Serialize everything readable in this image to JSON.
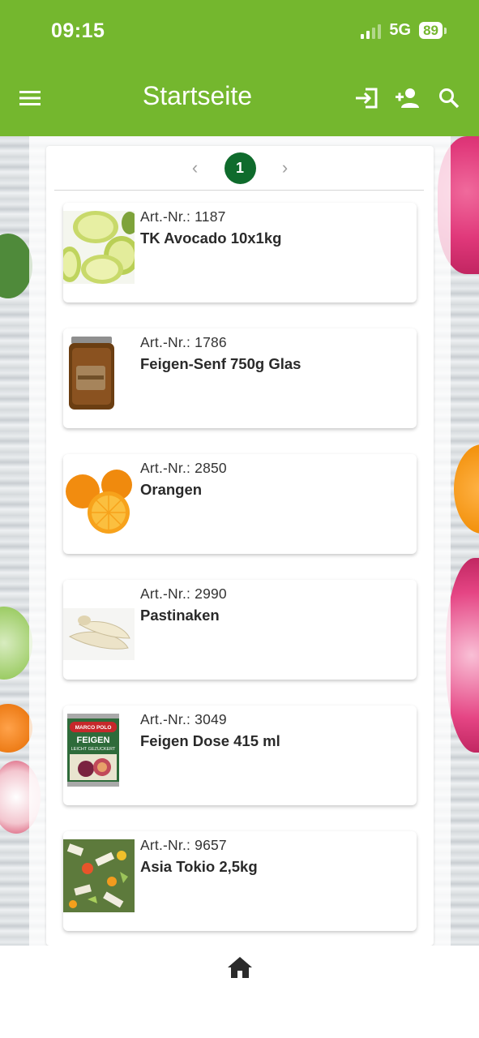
{
  "status_bar": {
    "time": "09:15",
    "network": "5G",
    "battery": "89"
  },
  "app_bar": {
    "title": "Startseite",
    "icons": [
      "menu-icon",
      "login-icon",
      "add-user-icon",
      "search-icon"
    ]
  },
  "pagination": {
    "current_page": "1",
    "prev": "‹",
    "next": "›"
  },
  "products": [
    {
      "art_nr": "Art.-Nr.: 1187",
      "name": "TK Avocado 10x1kg",
      "image": "avocado"
    },
    {
      "art_nr": "Art.-Nr.: 1786",
      "name": "Feigen-Senf 750g Glas",
      "image": "jar"
    },
    {
      "art_nr": "Art.-Nr.: 2850",
      "name": "Orangen",
      "image": "oranges"
    },
    {
      "art_nr": "Art.-Nr.: 2990",
      "name": "Pastinaken",
      "image": "parsnips"
    },
    {
      "art_nr": "Art.-Nr.: 3049",
      "name": "Feigen Dose 415 ml",
      "image": "can",
      "image_text": [
        "MARCO POLO",
        "FEIGEN",
        "LEICHT GEZUCKERT"
      ]
    },
    {
      "art_nr": "Art.-Nr.: 9657",
      "name": "Asia Tokio 2,5kg",
      "image": "veggie-mix"
    }
  ],
  "bottom_nav": {
    "icons": [
      "home-icon"
    ]
  },
  "colors": {
    "primary": "#74b72e",
    "page_active": "#0f6b2c"
  }
}
